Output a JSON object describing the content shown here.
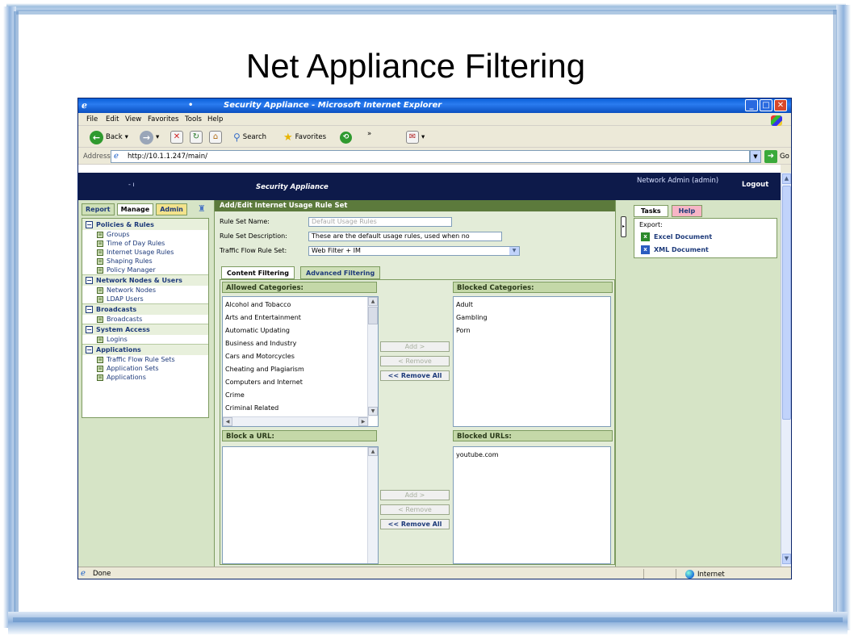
{
  "slide_title": "Net Appliance Filtering",
  "window": {
    "title": "Security Appliance - Microsoft Internet Explorer",
    "title_dot": "•",
    "buttons": {
      "min": "_",
      "max": "□",
      "close": "✕"
    }
  },
  "menu": [
    "File",
    "Edit",
    "View",
    "Favorites",
    "Tools",
    "Help"
  ],
  "toolbar": {
    "back": "Back",
    "search": "Search",
    "favorites": "Favorites",
    "chevron": "»"
  },
  "address": {
    "label": "Address",
    "url": "http://10.1.1.247/main/",
    "go": "Go"
  },
  "app_header": {
    "brand": "Security Appliance",
    "dots": "-  ı",
    "user": "Network Admin (admin)",
    "logout": "Logout"
  },
  "left_tabs": {
    "report": "Report",
    "manage": "Manage",
    "admin": "Admin"
  },
  "nav": [
    {
      "section": "Policies & Rules",
      "items": [
        "Groups",
        "Time of Day Rules",
        "Internet Usage Rules",
        "Shaping Rules",
        "Policy Manager"
      ]
    },
    {
      "section": "Network Nodes & Users",
      "items": [
        "Network Nodes",
        "LDAP Users"
      ]
    },
    {
      "section": "Broadcasts",
      "items": [
        "Broadcasts"
      ]
    },
    {
      "section": "System Access",
      "items": [
        "Logins"
      ]
    },
    {
      "section": "Applications",
      "items": [
        "Traffic Flow Rule Sets",
        "Application Sets",
        "Applications"
      ]
    }
  ],
  "form": {
    "heading": "Add/Edit Internet Usage Rule Set",
    "rule_set_name_label": "Rule Set Name:",
    "rule_set_name_value": "Default Usage Rules",
    "rule_set_desc_label": "Rule Set Description:",
    "rule_set_desc_value": "These are the default usage rules, used when no",
    "traffic_flow_label": "Traffic Flow Rule Set:",
    "traffic_flow_value": "Web Filter + IM",
    "tab_content": "Content Filtering",
    "tab_advanced": "Advanced Filtering",
    "allowed_header": "Allowed Categories:",
    "blocked_header": "Blocked Categories:",
    "allowed": [
      "Alcohol and Tobacco",
      "Arts and Entertainment",
      "Automatic Updating",
      "Business and Industry",
      "Cars and Motorcycles",
      "Cheating and Plagiarism",
      "Computers and Internet",
      "Crime",
      "Criminal Related"
    ],
    "blocked": [
      "Adult",
      "Gambling",
      "Porn"
    ],
    "add_btn": "Add >",
    "remove_btn": "< Remove",
    "remove_all_btn": "<< Remove All",
    "block_url_header": "Block a URL:",
    "blocked_urls_header": "Blocked URLs:",
    "blocked_urls": [
      "youtube.com"
    ]
  },
  "right_panel": {
    "tasks_tab": "Tasks",
    "help_tab": "Help",
    "export_label": "Export:",
    "excel": "Excel Document",
    "xml": "XML Document"
  },
  "status": {
    "done": "Done",
    "zone": "Internet"
  }
}
